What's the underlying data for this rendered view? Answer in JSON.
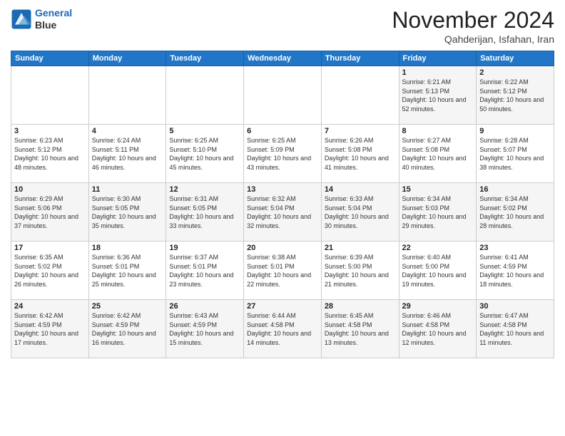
{
  "logo": {
    "line1": "General",
    "line2": "Blue"
  },
  "title": "November 2024",
  "location": "Qahderijan, Isfahan, Iran",
  "weekdays": [
    "Sunday",
    "Monday",
    "Tuesday",
    "Wednesday",
    "Thursday",
    "Friday",
    "Saturday"
  ],
  "weeks": [
    [
      {
        "day": "",
        "info": ""
      },
      {
        "day": "",
        "info": ""
      },
      {
        "day": "",
        "info": ""
      },
      {
        "day": "",
        "info": ""
      },
      {
        "day": "",
        "info": ""
      },
      {
        "day": "1",
        "info": "Sunrise: 6:21 AM\nSunset: 5:13 PM\nDaylight: 10 hours and 52 minutes."
      },
      {
        "day": "2",
        "info": "Sunrise: 6:22 AM\nSunset: 5:12 PM\nDaylight: 10 hours and 50 minutes."
      }
    ],
    [
      {
        "day": "3",
        "info": "Sunrise: 6:23 AM\nSunset: 5:12 PM\nDaylight: 10 hours and 48 minutes."
      },
      {
        "day": "4",
        "info": "Sunrise: 6:24 AM\nSunset: 5:11 PM\nDaylight: 10 hours and 46 minutes."
      },
      {
        "day": "5",
        "info": "Sunrise: 6:25 AM\nSunset: 5:10 PM\nDaylight: 10 hours and 45 minutes."
      },
      {
        "day": "6",
        "info": "Sunrise: 6:25 AM\nSunset: 5:09 PM\nDaylight: 10 hours and 43 minutes."
      },
      {
        "day": "7",
        "info": "Sunrise: 6:26 AM\nSunset: 5:08 PM\nDaylight: 10 hours and 41 minutes."
      },
      {
        "day": "8",
        "info": "Sunrise: 6:27 AM\nSunset: 5:08 PM\nDaylight: 10 hours and 40 minutes."
      },
      {
        "day": "9",
        "info": "Sunrise: 6:28 AM\nSunset: 5:07 PM\nDaylight: 10 hours and 38 minutes."
      }
    ],
    [
      {
        "day": "10",
        "info": "Sunrise: 6:29 AM\nSunset: 5:06 PM\nDaylight: 10 hours and 37 minutes."
      },
      {
        "day": "11",
        "info": "Sunrise: 6:30 AM\nSunset: 5:05 PM\nDaylight: 10 hours and 35 minutes."
      },
      {
        "day": "12",
        "info": "Sunrise: 6:31 AM\nSunset: 5:05 PM\nDaylight: 10 hours and 33 minutes."
      },
      {
        "day": "13",
        "info": "Sunrise: 6:32 AM\nSunset: 5:04 PM\nDaylight: 10 hours and 32 minutes."
      },
      {
        "day": "14",
        "info": "Sunrise: 6:33 AM\nSunset: 5:04 PM\nDaylight: 10 hours and 30 minutes."
      },
      {
        "day": "15",
        "info": "Sunrise: 6:34 AM\nSunset: 5:03 PM\nDaylight: 10 hours and 29 minutes."
      },
      {
        "day": "16",
        "info": "Sunrise: 6:34 AM\nSunset: 5:02 PM\nDaylight: 10 hours and 28 minutes."
      }
    ],
    [
      {
        "day": "17",
        "info": "Sunrise: 6:35 AM\nSunset: 5:02 PM\nDaylight: 10 hours and 26 minutes."
      },
      {
        "day": "18",
        "info": "Sunrise: 6:36 AM\nSunset: 5:01 PM\nDaylight: 10 hours and 25 minutes."
      },
      {
        "day": "19",
        "info": "Sunrise: 6:37 AM\nSunset: 5:01 PM\nDaylight: 10 hours and 23 minutes."
      },
      {
        "day": "20",
        "info": "Sunrise: 6:38 AM\nSunset: 5:01 PM\nDaylight: 10 hours and 22 minutes."
      },
      {
        "day": "21",
        "info": "Sunrise: 6:39 AM\nSunset: 5:00 PM\nDaylight: 10 hours and 21 minutes."
      },
      {
        "day": "22",
        "info": "Sunrise: 6:40 AM\nSunset: 5:00 PM\nDaylight: 10 hours and 19 minutes."
      },
      {
        "day": "23",
        "info": "Sunrise: 6:41 AM\nSunset: 4:59 PM\nDaylight: 10 hours and 18 minutes."
      }
    ],
    [
      {
        "day": "24",
        "info": "Sunrise: 6:42 AM\nSunset: 4:59 PM\nDaylight: 10 hours and 17 minutes."
      },
      {
        "day": "25",
        "info": "Sunrise: 6:42 AM\nSunset: 4:59 PM\nDaylight: 10 hours and 16 minutes."
      },
      {
        "day": "26",
        "info": "Sunrise: 6:43 AM\nSunset: 4:59 PM\nDaylight: 10 hours and 15 minutes."
      },
      {
        "day": "27",
        "info": "Sunrise: 6:44 AM\nSunset: 4:58 PM\nDaylight: 10 hours and 14 minutes."
      },
      {
        "day": "28",
        "info": "Sunrise: 6:45 AM\nSunset: 4:58 PM\nDaylight: 10 hours and 13 minutes."
      },
      {
        "day": "29",
        "info": "Sunrise: 6:46 AM\nSunset: 4:58 PM\nDaylight: 10 hours and 12 minutes."
      },
      {
        "day": "30",
        "info": "Sunrise: 6:47 AM\nSunset: 4:58 PM\nDaylight: 10 hours and 11 minutes."
      }
    ]
  ]
}
